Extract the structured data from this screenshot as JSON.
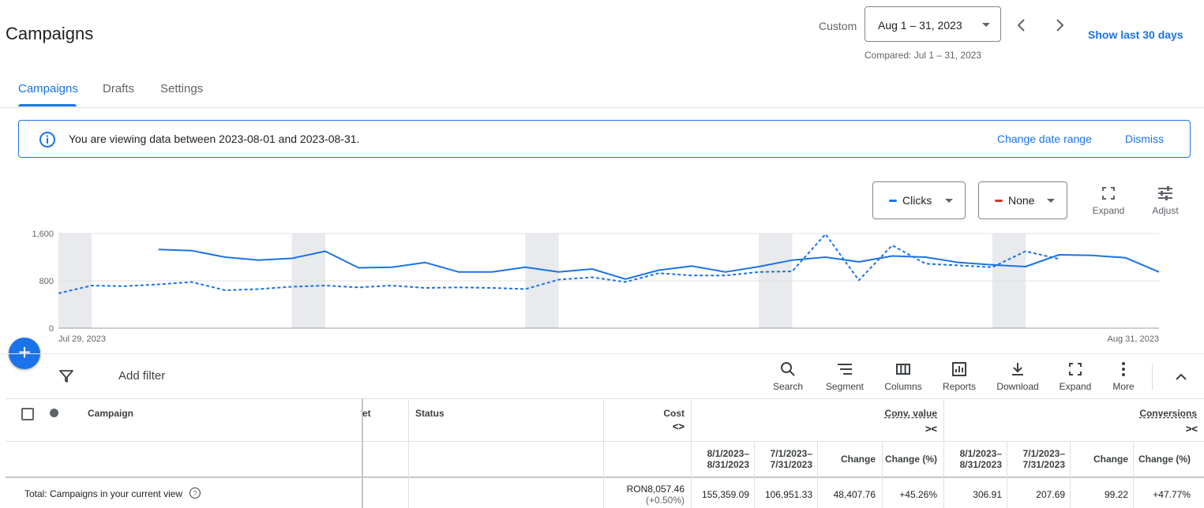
{
  "header": {
    "title": "Campaigns",
    "custom_label": "Custom",
    "date_range": "Aug 1 – 31, 2023",
    "compared": "Compared: Jul 1 – 31, 2023",
    "show_last_30": "Show last 30 days"
  },
  "tabs": [
    {
      "label": "Campaigns",
      "active": true
    },
    {
      "label": "Drafts",
      "active": false
    },
    {
      "label": "Settings",
      "active": false
    }
  ],
  "banner": {
    "message": "You are viewing data between 2023-08-01 and 2023-08-31.",
    "change_link": "Change date range",
    "dismiss_link": "Dismiss"
  },
  "chart_controls": {
    "metric1": "Clicks",
    "metric1_color": "#1a73e8",
    "metric2": "None",
    "metric2_color": "#d93025",
    "expand": "Expand",
    "adjust": "Adjust"
  },
  "chart_data": {
    "type": "line",
    "y_ticks": [
      "1,600",
      "800",
      "0"
    ],
    "ylim": [
      0,
      1600
    ],
    "x_start_label": "Jul 29, 2023",
    "x_end_label": "Aug 31, 2023",
    "grid": true,
    "weekend_shading": [
      [
        0,
        1
      ],
      [
        7,
        8
      ],
      [
        14,
        15
      ],
      [
        21,
        22
      ],
      [
        28,
        29
      ]
    ],
    "series": [
      {
        "style": "solid",
        "color": "#1a73e8",
        "start_index": 3,
        "values": [
          1330,
          1310,
          1200,
          1150,
          1180,
          1300,
          1020,
          1030,
          1110,
          950,
          950,
          1030,
          950,
          1000,
          830,
          980,
          1050,
          950,
          1040,
          1150,
          1200,
          1120,
          1220,
          1200,
          1110,
          1070,
          1040,
          1240,
          1230,
          1190,
          950
        ]
      },
      {
        "style": "dashed",
        "color": "#1a73e8",
        "start_index": 0,
        "values": [
          590,
          720,
          710,
          740,
          780,
          640,
          660,
          700,
          720,
          690,
          720,
          680,
          690,
          680,
          660,
          820,
          860,
          780,
          930,
          890,
          890,
          950,
          960,
          1590,
          810,
          1400,
          1090,
          1060,
          1030,
          1300,
          1170
        ]
      }
    ]
  },
  "toolbar": {
    "add_filter": "Add filter",
    "buttons": [
      "Search",
      "Segment",
      "Columns",
      "Reports",
      "Download",
      "Expand",
      "More"
    ]
  },
  "table": {
    "headers": {
      "campaign": "Campaign",
      "budget_partial": "et",
      "status": "Status",
      "cost": "Cost",
      "conv_value": "Conv. value",
      "conversions": "Conversions"
    },
    "subheaders": {
      "period1": "8/1/2023–\n8/31/2023",
      "period2": "7/1/2023–\n7/31/2023",
      "change": "Change",
      "change_pct": "Change (%)"
    },
    "total_row": {
      "label": "Total: Campaigns in your current view",
      "cost": "RON8,057.46",
      "cost_change": "(+0.50%)",
      "conv_value": [
        "155,359.09",
        "106,951.33",
        "48,407.76",
        "+45.26%"
      ],
      "conversions": [
        "306.91",
        "207.69",
        "99.22",
        "+47.77%"
      ]
    }
  }
}
